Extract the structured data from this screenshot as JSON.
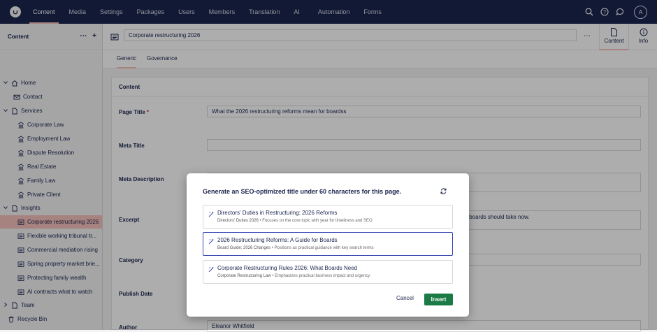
{
  "nav": {
    "items": [
      "Content",
      "Media",
      "Settings",
      "Packages",
      "Users",
      "Members",
      "Translation",
      "AI",
      "Automation",
      "Forms"
    ],
    "active": "Content",
    "avatar_initial": "A"
  },
  "sidebar": {
    "title": "Content",
    "tree": [
      {
        "label": "Home",
        "icon": "home-icon"
      },
      {
        "label": "Contact",
        "icon": "mail-icon"
      },
      {
        "label": "Services",
        "icon": "document-icon"
      },
      {
        "label": "Corporate Law",
        "icon": "building-icon"
      },
      {
        "label": "Employment Law",
        "icon": "building-icon"
      },
      {
        "label": "Dispute Resolution",
        "icon": "building-icon"
      },
      {
        "label": "Real Estate",
        "icon": "building-icon"
      },
      {
        "label": "Family Law",
        "icon": "building-icon"
      },
      {
        "label": "Private Client",
        "icon": "building-icon"
      },
      {
        "label": "Insights",
        "icon": "document-icon"
      },
      {
        "label": "Corporate restructuring 2026",
        "icon": "newspaper-icon"
      },
      {
        "label": "Flexible working tribunal tr...",
        "icon": "newspaper-icon"
      },
      {
        "label": "Commercial mediation rising",
        "icon": "newspaper-icon"
      },
      {
        "label": "Spring property market brie...",
        "icon": "newspaper-icon"
      },
      {
        "label": "Protecting family wealth",
        "icon": "newspaper-icon"
      },
      {
        "label": "AI contracts what to watch",
        "icon": "newspaper-icon"
      },
      {
        "label": "Team",
        "icon": "document-icon"
      },
      {
        "label": "Recycle Bin",
        "icon": "trash-icon"
      }
    ]
  },
  "editor": {
    "document_name": "Corporate restructuring 2026",
    "apps": {
      "content": "Content",
      "info": "Info"
    },
    "tabs": {
      "generic": "Generic",
      "governance": "Governance"
    },
    "group_title": "Content",
    "props": {
      "page_title_label": "Page Title",
      "required_mark": "*",
      "page_title_value": "What the 2026 restructuring reforms mean for boardss",
      "meta_title_label": "Meta Title",
      "meta_description_label": "Meta Description",
      "excerpt_label": "Excerpt",
      "excerpt_value_tail": "s boards should take now.",
      "category_label": "Category",
      "publish_date_label": "Publish Date",
      "author_label": "Author",
      "author_value": "Eleanor Whitfield"
    }
  },
  "dialog": {
    "title": "Generate an SEO-optimized title under 60 characters for this page.",
    "suggestions": [
      {
        "title": "Directors' Duties in Restructuring: 2026 Reforms",
        "keywords": "Directors' Duties 2026",
        "sep": "•",
        "note": "Focuses on the core topic with year for timeliness and SEO"
      },
      {
        "title": "2026 Restructuring Reforms: A Guide for Boards",
        "keywords": "Board Guide; 2026 Changes",
        "sep": "•",
        "note": "Positions as practical guidance with key search terms"
      },
      {
        "title": "Corporate Restructuring Rules 2026: What Boards Need",
        "keywords": "Corporate Restructuring Law",
        "sep": "•",
        "note": "Emphasizes practical business impact and urgency"
      }
    ],
    "selected_index": 1,
    "cancel_label": "Cancel",
    "insert_label": "Insert"
  },
  "colors": {
    "topbar": "#1b264f",
    "selected_tree": "#f5c1bc",
    "insert_button": "#1b7a45",
    "selected_border": "#3544b1"
  }
}
